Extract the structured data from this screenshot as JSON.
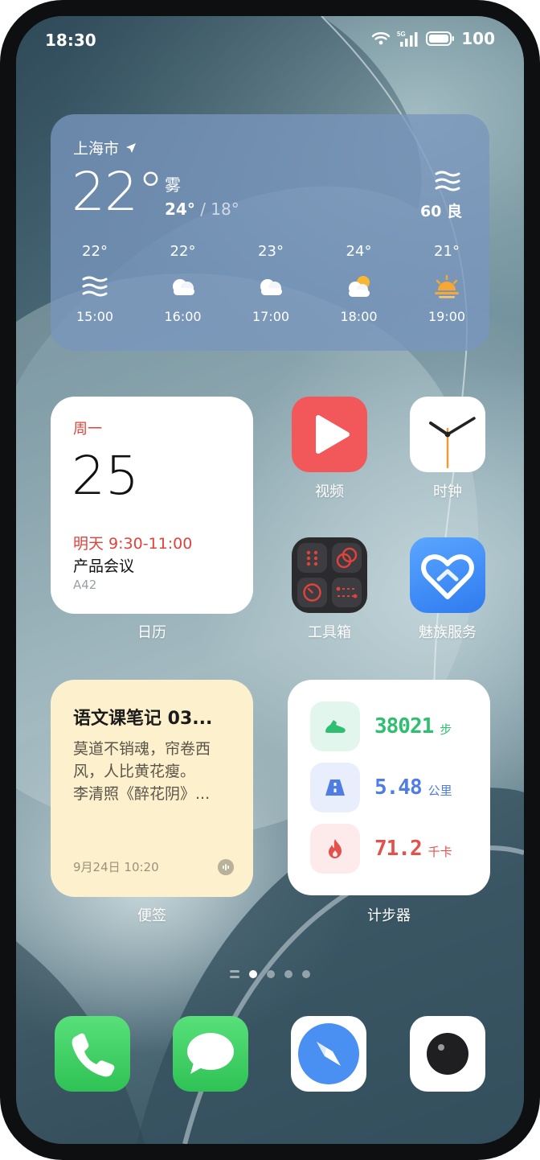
{
  "status_bar": {
    "time": "18:30",
    "network": "5G",
    "battery": "100"
  },
  "weather": {
    "city": "上海市",
    "temperature": "22°",
    "condition": "雾",
    "high": "24°",
    "separator": " / ",
    "low": "18°",
    "aqi": "60 良",
    "forecast": [
      {
        "temp": "22°",
        "icon": "fog-icon",
        "time": "15:00"
      },
      {
        "temp": "22°",
        "icon": "cloudy-icon",
        "time": "16:00"
      },
      {
        "temp": "23°",
        "icon": "cloudy-icon",
        "time": "17:00"
      },
      {
        "temp": "24°",
        "icon": "partly-sunny-icon",
        "time": "18:00"
      },
      {
        "temp": "21°",
        "icon": "sunset-icon",
        "time": "19:00"
      }
    ]
  },
  "calendar": {
    "weekday": "周一",
    "date": "25",
    "event_time": "明天 9:30-11:00",
    "event_title": "产品会议",
    "event_location": "A42",
    "label": "日历"
  },
  "apps": {
    "video": "视频",
    "clock": "时钟",
    "toolbox": "工具箱",
    "meizu_service": "魅族服务"
  },
  "note": {
    "title": "语文课笔记 03...",
    "body_line1": "莫道不销魂，帘卷西",
    "body_line2": "风，人比黄花瘦。",
    "body_line3": "李清照《醉花阴》...",
    "date": "9月24日 10:20",
    "label": "便签"
  },
  "pedometer": {
    "steps": "38021",
    "steps_unit": "步",
    "distance": "5.48",
    "distance_unit": "公里",
    "calories": "71.2",
    "calories_unit": "千卡",
    "label": "计步器"
  },
  "pager": {
    "pages": 4,
    "active": 1
  },
  "dock": [
    "phone-icon",
    "messages-icon",
    "browser-icon",
    "camera-icon"
  ],
  "colors": {
    "red": "#e0433b",
    "steps_green": "#2fbf71",
    "distance_blue": "#4f7de3",
    "calories_red": "#e4504a",
    "weather_bg": "#7896be",
    "note_bg": "#fdf0cc"
  }
}
